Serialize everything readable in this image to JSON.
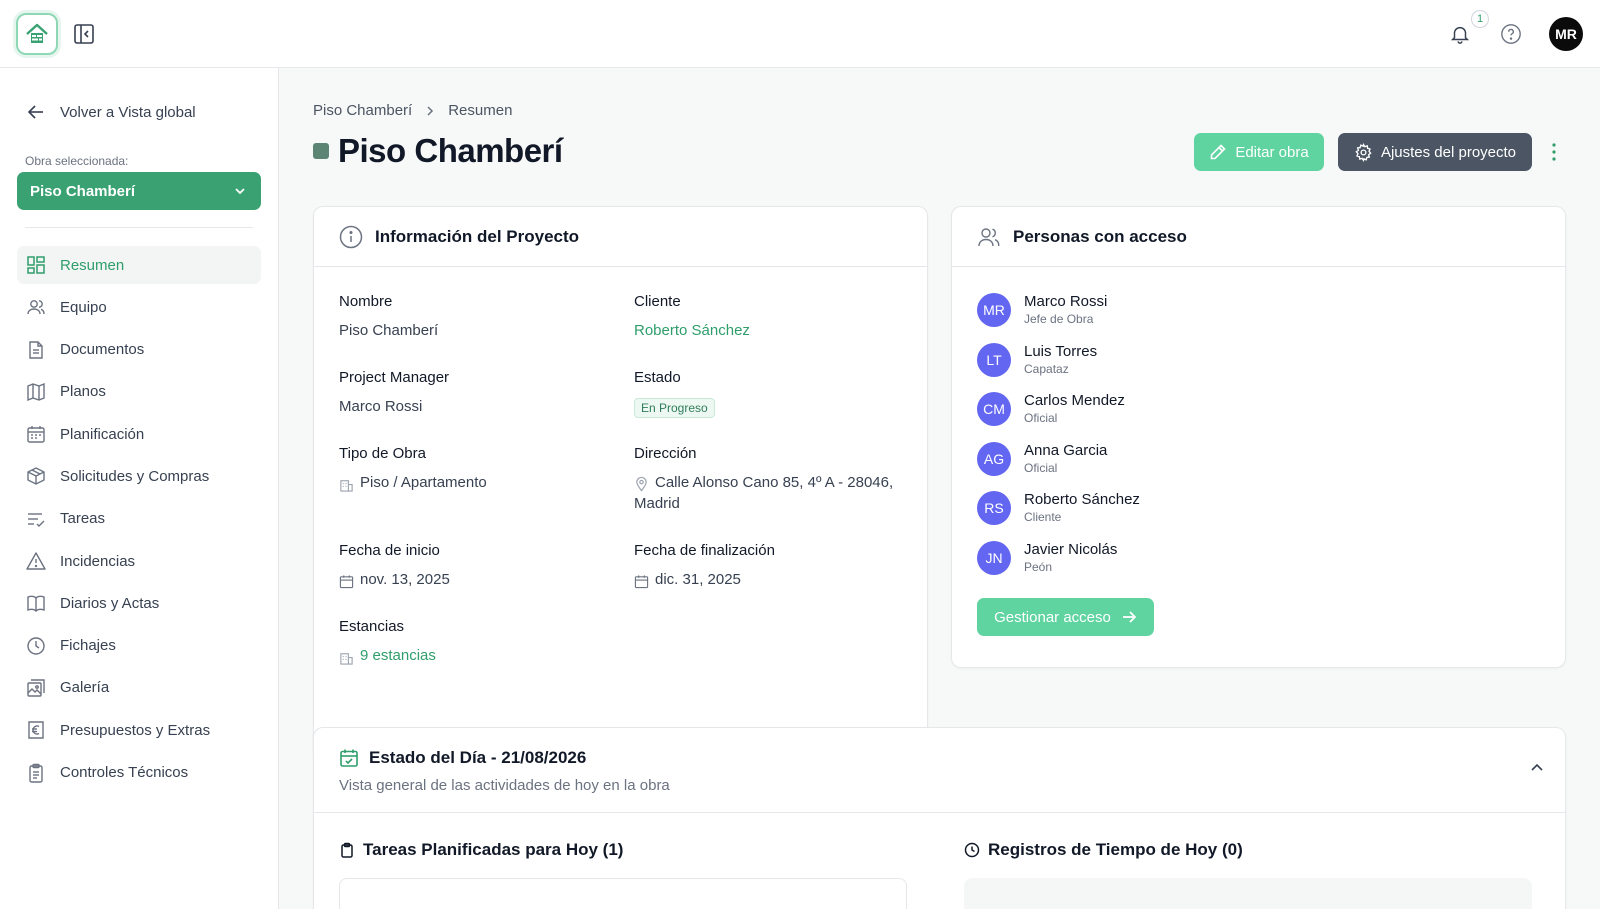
{
  "topbar": {
    "notification_count": "1",
    "user_initials": "MR"
  },
  "sidebar": {
    "back_label": "Volver a Vista global",
    "obra_label": "Obra seleccionada:",
    "obra_selected": "Piso Chamberí",
    "items": [
      {
        "label": "Resumen",
        "icon": "grid-icon",
        "active": true
      },
      {
        "label": "Equipo",
        "icon": "users-icon"
      },
      {
        "label": "Documentos",
        "icon": "document-icon"
      },
      {
        "label": "Planos",
        "icon": "map-icon"
      },
      {
        "label": "Planificación",
        "icon": "calendar-icon"
      },
      {
        "label": "Solicitudes y Compras",
        "icon": "package-icon"
      },
      {
        "label": "Tareas",
        "icon": "list-check-icon"
      },
      {
        "label": "Incidencias",
        "icon": "warning-icon"
      },
      {
        "label": "Diarios y Actas",
        "icon": "book-icon"
      },
      {
        "label": "Fichajes",
        "icon": "clock-icon"
      },
      {
        "label": "Galería",
        "icon": "gallery-icon"
      },
      {
        "label": "Presupuestos y Extras",
        "icon": "euro-icon"
      },
      {
        "label": "Controles Técnicos",
        "icon": "clipboard-icon"
      }
    ]
  },
  "breadcrumb": {
    "parent": "Piso Chamberí",
    "current": "Resumen"
  },
  "page": {
    "title": "Piso Chamberí",
    "edit_label": "Editar obra",
    "settings_label": "Ajustes del proyecto"
  },
  "info": {
    "title": "Información del Proyecto",
    "nombre_label": "Nombre",
    "nombre": "Piso Chamberí",
    "cliente_label": "Cliente",
    "cliente": "Roberto Sánchez",
    "pm_label": "Project Manager",
    "pm": "Marco Rossi",
    "estado_label": "Estado",
    "estado": "En Progreso",
    "tipo_label": "Tipo de Obra",
    "tipo": "Piso / Apartamento",
    "direccion_label": "Dirección",
    "direccion_1": "Calle Alonso Cano 85, 4º A - 28046,",
    "direccion_2": "Madrid",
    "inicio_label": "Fecha de inicio",
    "inicio": "nov. 13, 2025",
    "fin_label": "Fecha de finalización",
    "fin": "dic. 31, 2025",
    "estancias_label": "Estancias",
    "estancias": "9 estancias"
  },
  "people": {
    "title": "Personas con acceso",
    "list": [
      {
        "initials": "MR",
        "name": "Marco Rossi",
        "role": "Jefe de Obra"
      },
      {
        "initials": "LT",
        "name": "Luis Torres",
        "role": "Capataz"
      },
      {
        "initials": "CM",
        "name": "Carlos Mendez",
        "role": "Oficial"
      },
      {
        "initials": "AG",
        "name": "Anna Garcia",
        "role": "Oficial"
      },
      {
        "initials": "RS",
        "name": "Roberto Sánchez",
        "role": "Cliente"
      },
      {
        "initials": "JN",
        "name": "Javier Nicolás",
        "role": "Peón"
      }
    ],
    "manage_label": "Gestionar acceso"
  },
  "day": {
    "title": "Estado del Día - 21/08/2026",
    "subtitle": "Vista general de las actividades de hoy en la obra",
    "tasks_title": "Tareas Planificadas para Hoy (1)",
    "time_title": "Registros de Tiempo de Hoy (0)"
  },
  "colors": {
    "accent": "#3aa272",
    "accent_light": "#5fd3a0",
    "dark_button": "#4b5563",
    "avatar": "#6366f1"
  }
}
